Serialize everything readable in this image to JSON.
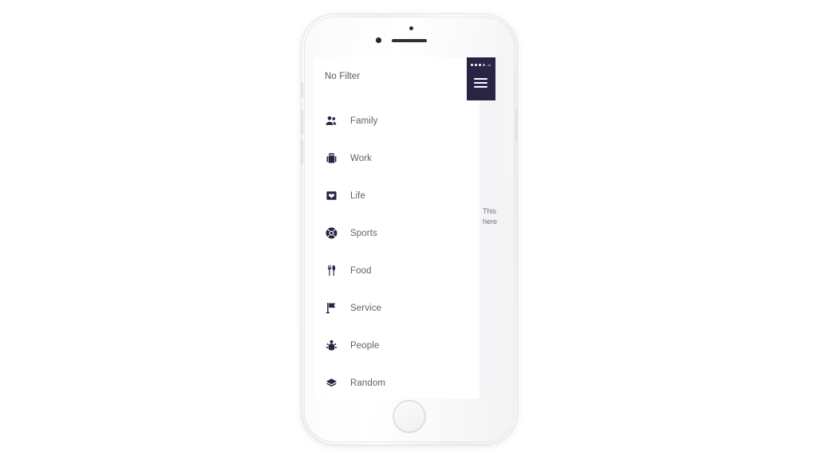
{
  "device": {
    "name": "smartphone-mockup",
    "home_button_label": "Home",
    "hardware": {
      "camera": "camera-icon",
      "proximity_sensor": "proximity-sensor-icon",
      "speaker": "speaker-grille-icon",
      "silent_switch": "silent-switch",
      "volume_up": "volume-up-button",
      "volume_down": "volume-down-button",
      "power": "power-button"
    }
  },
  "status_bar": {
    "signal_dots": [
      "filled",
      "filled",
      "filled",
      "hollow"
    ],
    "carrier": "od"
  },
  "drawer": {
    "menu_icon": "hamburger-menu-icon",
    "background_color": "#2a2344"
  },
  "list_panel": {
    "title": "No Filter",
    "background_color": "#ffffff",
    "text_color": "#5f5f6d",
    "icon_color": "#2a2344",
    "items": [
      {
        "label": "Family",
        "icon": "people-group-icon"
      },
      {
        "label": "Work",
        "icon": "briefcase-icon"
      },
      {
        "label": "Life",
        "icon": "heart-square-icon"
      },
      {
        "label": "Sports",
        "icon": "life-buoy-icon"
      },
      {
        "label": "Food",
        "icon": "fork-knife-icon"
      },
      {
        "label": "Service",
        "icon": "flag-icon"
      },
      {
        "label": "People",
        "icon": "users-icon"
      },
      {
        "label": "Random",
        "icon": "layers-icon"
      }
    ]
  },
  "background_content": {
    "clipped_line_1": "This",
    "clipped_line_2": "here",
    "panel_color": "#f4f4f7"
  }
}
